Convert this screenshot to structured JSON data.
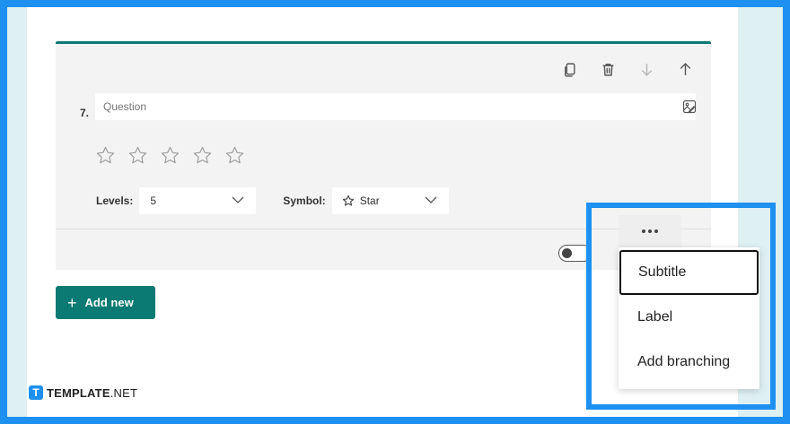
{
  "question": {
    "number": "7.",
    "placeholder": "Question",
    "stars_count": 5,
    "toolbar": {
      "icons": [
        "copy-icon",
        "delete-icon",
        "move-down-icon",
        "move-up-icon"
      ]
    },
    "levels_label": "Levels:",
    "levels_value": "5",
    "symbol_label": "Symbol:",
    "symbol_value": "Star",
    "required_toggle_on": false
  },
  "add_new_label": "Add new",
  "more_menu": {
    "items": [
      "Subtitle",
      "Label",
      "Add branching"
    ],
    "selected": "Subtitle"
  },
  "brand": {
    "logo_letter": "T",
    "name_bold": "TEMPLATE",
    "name_suffix": ".NET"
  },
  "colors": {
    "accent": "#0b7a73",
    "highlight": "#1e90f0",
    "card_bg": "#f3f3f3"
  }
}
